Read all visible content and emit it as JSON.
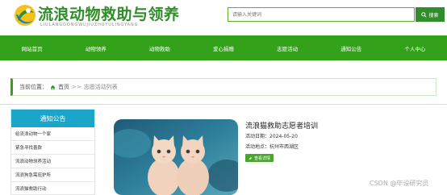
{
  "header": {
    "site_title": "流浪动物救助与领养",
    "site_subtitle": "LIULANGDONGWUJIUZHUYULINGYANG",
    "logo_icon": "globe-leaf-icon"
  },
  "search": {
    "placeholder": "请输入关键词",
    "button_label": "搜索",
    "button_icon": "search-icon"
  },
  "nav": {
    "items": [
      "网站首页",
      "动物领养",
      "动物救助",
      "爱心捐赠",
      "志愿活动",
      "通知公告",
      "个人中心"
    ]
  },
  "breadcrumb": {
    "prefix": "当前位置：",
    "home": "首页",
    "separator": ">>",
    "current": "志愿活动列表"
  },
  "sidebar": {
    "title": "通知公告",
    "items": [
      "给流浪动物一个家",
      "紧急寻找善款",
      "流浪动物领养活动",
      "流浪狗急需庇护所",
      "流浪猫救助行动"
    ]
  },
  "post": {
    "title": "流浪猫救助志愿者培训",
    "date_label": "活动日期：",
    "date": "2024-05-20",
    "location_label": "活动地点：",
    "location": "杭州市西湖区",
    "detail_button": "查看详情",
    "detail_icon": "detail-icon",
    "image_subject": "two-kittens-photo"
  },
  "watermark": "CSDN @毕设研究员",
  "colors": {
    "brand_green": "#34a11a",
    "title_green": "#2f8d2a",
    "sidebar_blue": "#1aa6c9"
  }
}
